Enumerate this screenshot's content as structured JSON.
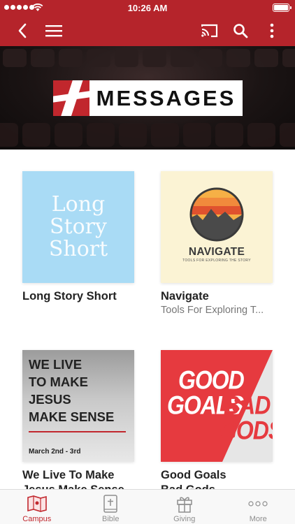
{
  "status_bar": {
    "time": "10:26 AM"
  },
  "header": {
    "icons": {
      "back": "chevron-left-icon",
      "menu": "hamburger-menu-icon",
      "cast": "cast-icon",
      "search": "search-icon",
      "more": "more-vertical-icon"
    }
  },
  "hero": {
    "logo_text": "MESSAGES",
    "logo_icon": "cross-icon"
  },
  "series": [
    {
      "title": "Long Story Short",
      "subtitle": "",
      "art_lines": [
        "Long",
        "Story",
        "Short"
      ]
    },
    {
      "title": "Navigate",
      "subtitle": "Tools For Exploring T...",
      "art_title": "NAVIGATE",
      "art_subtitle": "TOOLS FOR EXPLORING THE STORY"
    },
    {
      "title": "We Live To Make",
      "title2": "Jesus Make Sense",
      "art_lines": [
        "WE LIVE",
        "TO MAKE",
        "JESUS",
        "MAKE SENSE"
      ],
      "art_date": "March 2nd - 3rd"
    },
    {
      "title": "Good Goals",
      "title2": "Bad Gods",
      "art_words": [
        "GOOD",
        "GOALS",
        "BAD",
        "GODS"
      ]
    }
  ],
  "tabs": [
    {
      "label": "Campus",
      "icon": "map-icon",
      "active": true
    },
    {
      "label": "Bible",
      "icon": "bible-icon",
      "active": false
    },
    {
      "label": "Giving",
      "icon": "gift-icon",
      "active": false
    },
    {
      "label": "More",
      "icon": "more-dots-icon",
      "active": false
    }
  ],
  "colors": {
    "brand": "#b5242b",
    "active_tab": "#c1272d",
    "inactive_tab": "#8e8e8e"
  }
}
